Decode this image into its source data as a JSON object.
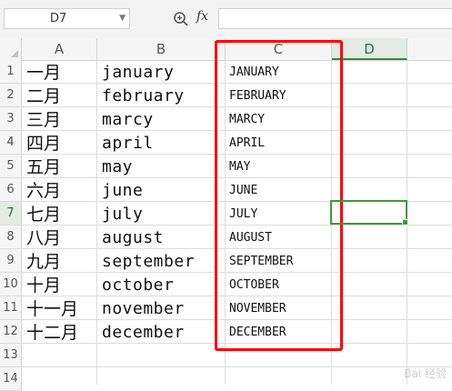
{
  "formula_bar": {
    "name_box_value": "D7",
    "fx_label": "fx",
    "formula_value": ""
  },
  "columns": [
    "A",
    "B",
    "C",
    "D"
  ],
  "rows": [
    {
      "num": "1",
      "a": "一月",
      "b": "january",
      "c": "JANUARY"
    },
    {
      "num": "2",
      "a": "二月",
      "b": "february",
      "c": "FEBRUARY"
    },
    {
      "num": "3",
      "a": "三月",
      "b": "marcy",
      "c": "MARCY"
    },
    {
      "num": "4",
      "a": "四月",
      "b": "april",
      "c": "APRIL"
    },
    {
      "num": "5",
      "a": "五月",
      "b": "may",
      "c": "MAY"
    },
    {
      "num": "6",
      "a": "六月",
      "b": "june",
      "c": "JUNE"
    },
    {
      "num": "7",
      "a": "七月",
      "b": "july",
      "c": "JULY"
    },
    {
      "num": "8",
      "a": "八月",
      "b": "august",
      "c": "AUGUST"
    },
    {
      "num": "9",
      "a": "九月",
      "b": "september",
      "c": "SEPTEMBER"
    },
    {
      "num": "10",
      "a": "十月",
      "b": "october",
      "c": "OCTOBER"
    },
    {
      "num": "11",
      "a": "十一月",
      "b": "november",
      "c": "NOVEMBER"
    },
    {
      "num": "12",
      "a": "十二月",
      "b": "december",
      "c": "DECEMBER"
    },
    {
      "num": "13",
      "a": "",
      "b": "",
      "c": ""
    },
    {
      "num": "14",
      "a": "",
      "b": "",
      "c": ""
    }
  ],
  "selection": {
    "cell": "D7",
    "accent_color": "#3a9a3a"
  },
  "highlight_color": "#ff0000",
  "watermark": "Bai 经验"
}
